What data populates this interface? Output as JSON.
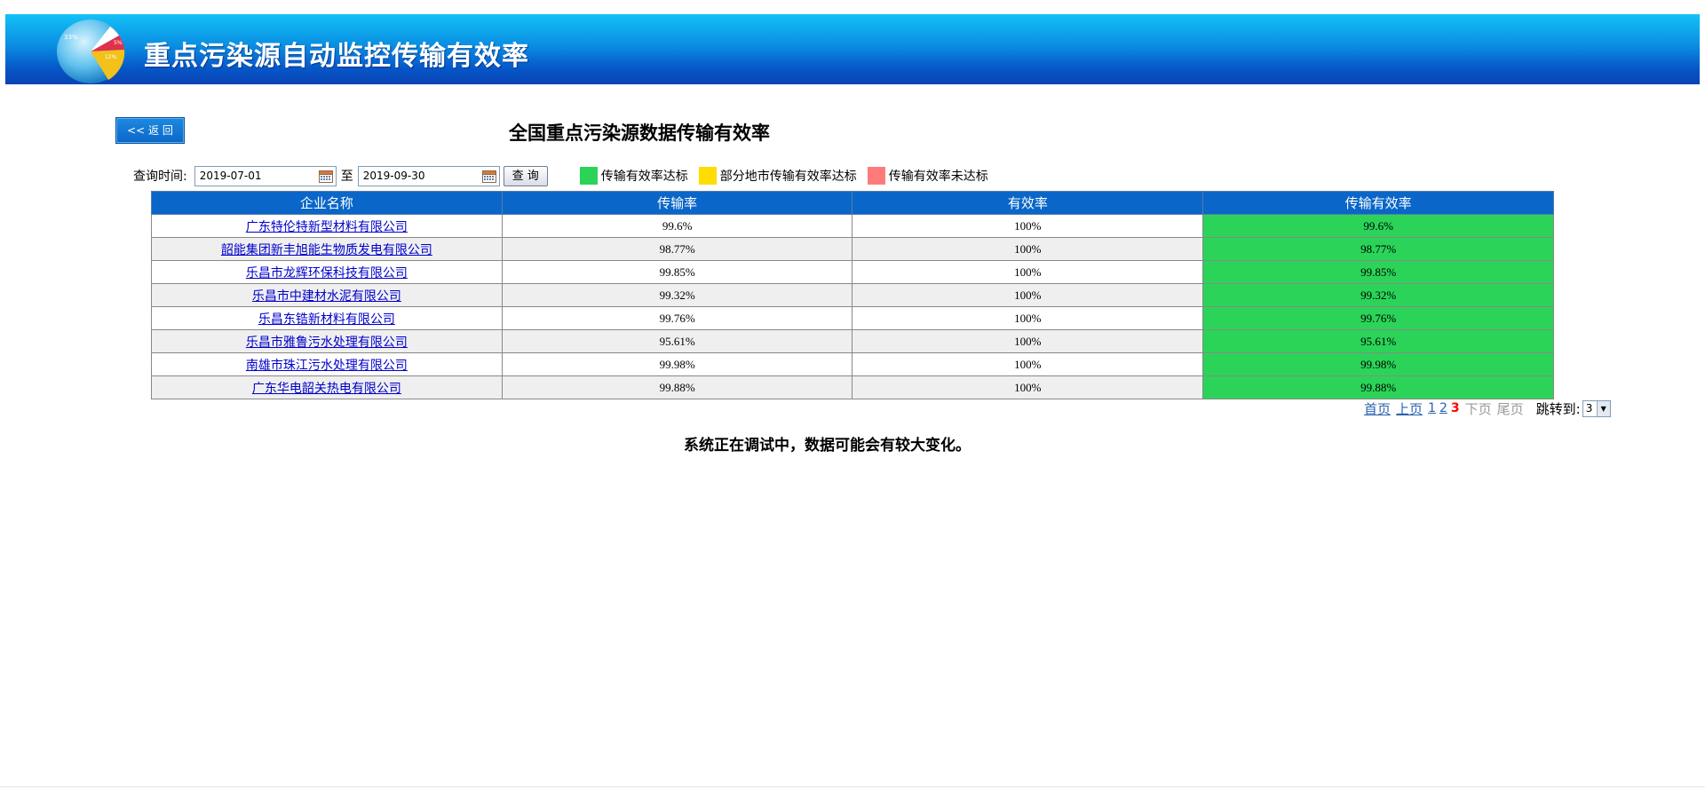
{
  "header": {
    "title": "重点污染源自动监控传输有效率",
    "logo_labels": [
      "33%",
      "5%",
      "12%"
    ]
  },
  "back_button_label": "<< 返 回",
  "page_title": "全国重点污染源数据传输有效率",
  "query": {
    "label": "查询时间:",
    "start_date": "2019-07-01",
    "to_label": "至",
    "end_date": "2019-09-30",
    "button_label": "查 询"
  },
  "legend": [
    {
      "label": "传输有效率达标",
      "color": "#2bd458"
    },
    {
      "label": "部分地市传输有效率达标",
      "color": "#ffdd00"
    },
    {
      "label": "传输有效率未达标",
      "color": "#ff7b7b"
    }
  ],
  "table": {
    "headers": [
      "企业名称",
      "传输率",
      "有效率",
      "传输有效率"
    ],
    "rows": [
      {
        "name": "广东特伦特新型材料有限公司",
        "transmission": "99.6%",
        "validity": "100%",
        "effective": "99.6%"
      },
      {
        "name": "韶能集团新丰旭能生物质发电有限公司",
        "transmission": "98.77%",
        "validity": "100%",
        "effective": "98.77%"
      },
      {
        "name": "乐昌市龙辉环保科技有限公司",
        "transmission": "99.85%",
        "validity": "100%",
        "effective": "99.85%"
      },
      {
        "name": "乐昌市中建材水泥有限公司",
        "transmission": "99.32%",
        "validity": "100%",
        "effective": "99.32%"
      },
      {
        "name": "乐昌东锆新材料有限公司",
        "transmission": "99.76%",
        "validity": "100%",
        "effective": "99.76%"
      },
      {
        "name": "乐昌市雅鲁污水处理有限公司",
        "transmission": "95.61%",
        "validity": "100%",
        "effective": "95.61%"
      },
      {
        "name": "南雄市珠江污水处理有限公司",
        "transmission": "99.98%",
        "validity": "100%",
        "effective": "99.98%"
      },
      {
        "name": "广东华电韶关热电有限公司",
        "transmission": "99.88%",
        "validity": "100%",
        "effective": "99.88%"
      }
    ]
  },
  "pagination": {
    "first": "首页",
    "prev": "上页",
    "pages": [
      "1",
      "2"
    ],
    "current": "3",
    "next": "下页",
    "last": "尾页",
    "jump_label": "跳转到:",
    "jump_value": "3"
  },
  "notice": "系统正在调试中，数据可能会有较大变化。",
  "colors": {
    "header_blue": "#0a66c8",
    "ok_green": "#2bd458",
    "partial_yellow": "#ffdd00",
    "fail_red": "#ff7b7b"
  }
}
